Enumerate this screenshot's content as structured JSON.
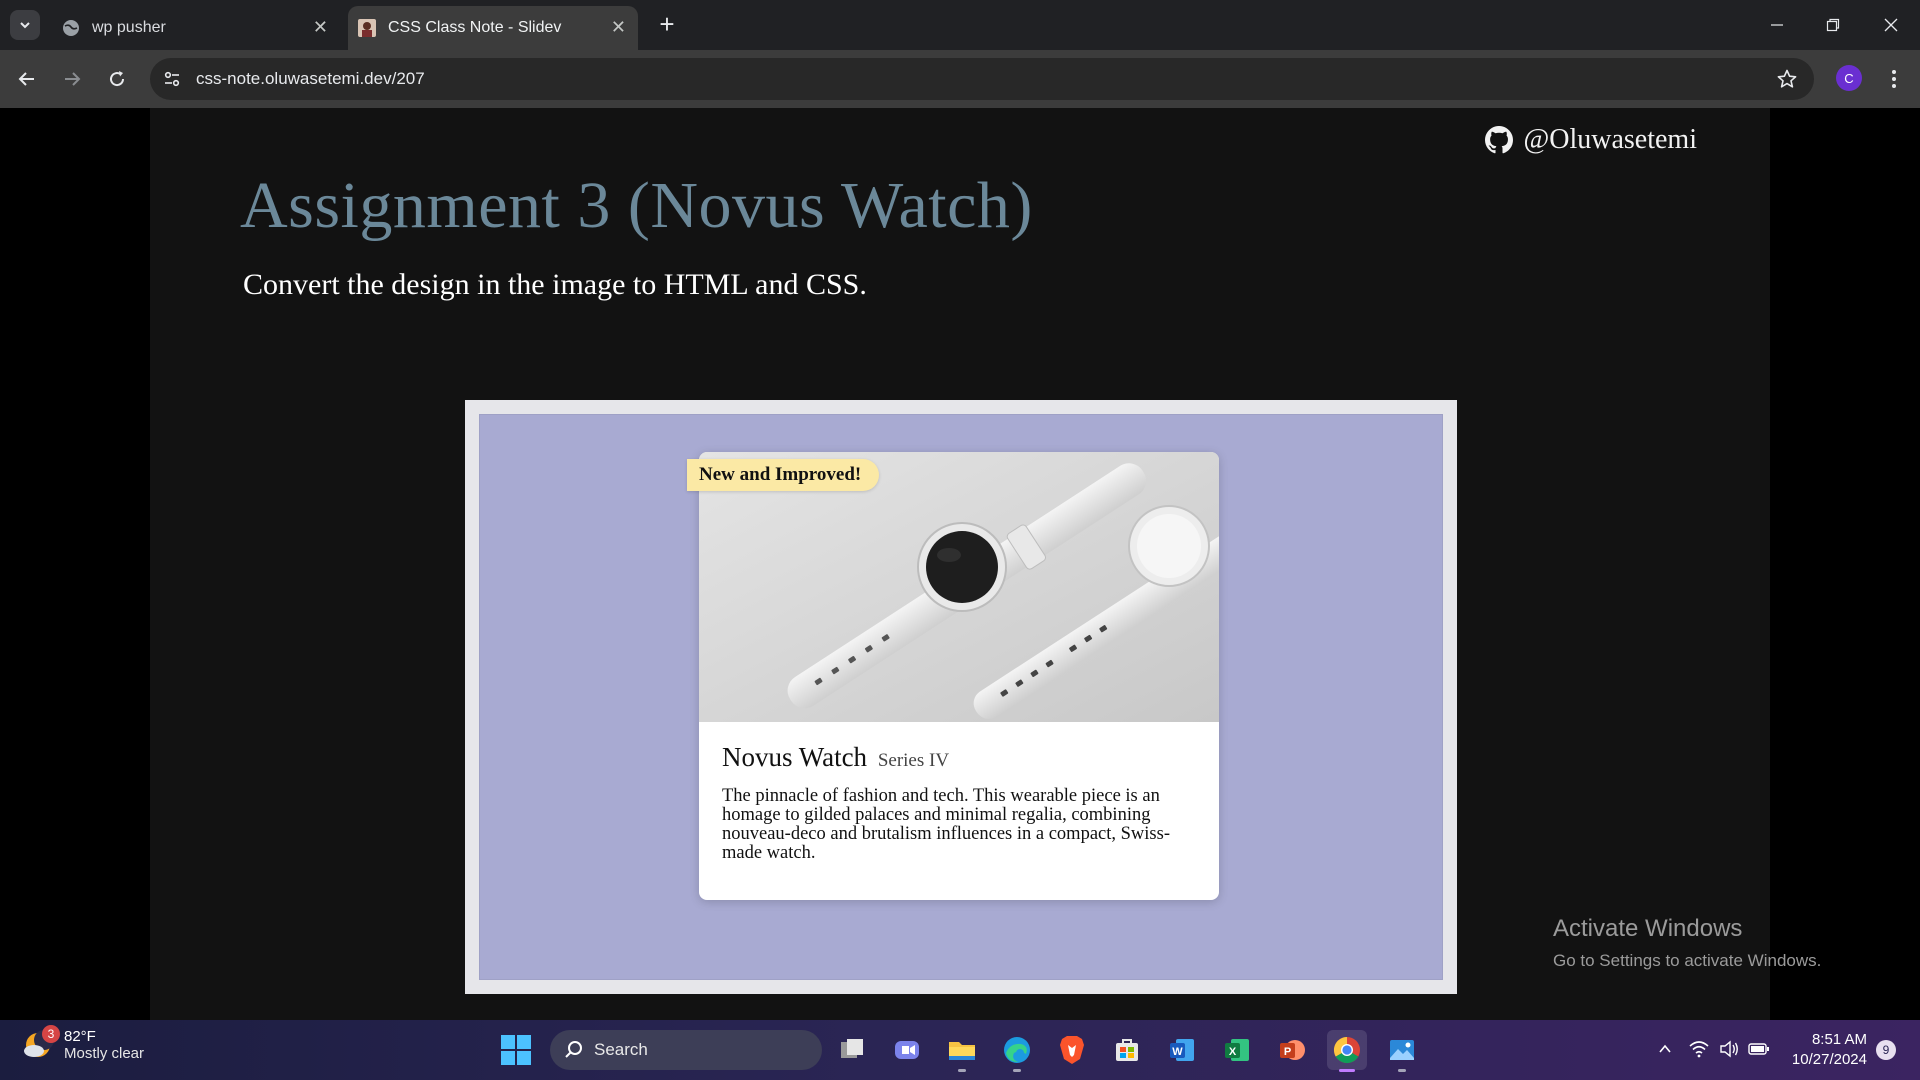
{
  "browser": {
    "tabs": [
      {
        "title": "wp pusher",
        "favicon": "globe-icon"
      },
      {
        "title": "CSS Class Note - Slidev",
        "favicon": "avatar-favicon",
        "active": true
      }
    ],
    "url": "css-note.oluwasetemi.dev/207",
    "profile_initial": "C"
  },
  "slide": {
    "handle": "@Oluwasetemi",
    "title": "Assignment 3 (Novus Watch)",
    "subtitle": "Convert the design in the image to HTML and CSS.",
    "card": {
      "badge": "New and Improved!",
      "product_name": "Novus Watch",
      "series": "Series IV",
      "description": "The pinnacle of fashion and tech. This wearable piece is an homage to gilded palaces and minimal regalia, combining nouveau-deco and brutalism influences in a compact, Swiss-made watch."
    },
    "colors": {
      "title": "#6b8899",
      "canvas": "#a8aad2",
      "badge": "#fbe9a5"
    }
  },
  "watermark": {
    "line1": "Activate Windows",
    "line2": "Go to Settings to activate Windows."
  },
  "taskbar": {
    "weather": {
      "temp": "82°F",
      "condition": "Mostly clear",
      "badge": "3"
    },
    "search_placeholder": "Search",
    "apps": [
      "task-view-icon",
      "teams-icon",
      "file-explorer-icon",
      "edge-icon",
      "brave-icon",
      "store-icon",
      "word-icon",
      "excel-icon",
      "powerpoint-icon",
      "chrome-icon",
      "photos-icon"
    ],
    "time": "8:51 AM",
    "date": "10/27/2024",
    "notifications": "9"
  }
}
